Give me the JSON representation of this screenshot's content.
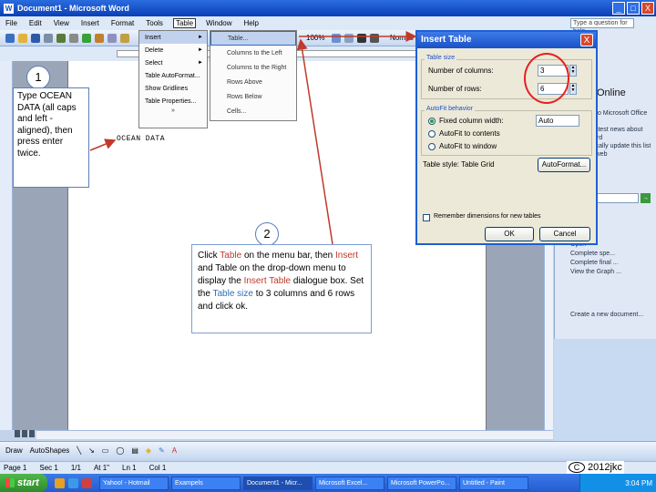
{
  "window": {
    "title": "Document1 - Microsoft Word",
    "app_icon": "W",
    "minimize": "_",
    "maximize": "□",
    "close": "X"
  },
  "menu": {
    "items": [
      "File",
      "Edit",
      "View",
      "Insert",
      "Format",
      "Tools",
      "Table",
      "Window",
      "Help"
    ],
    "active": "Table",
    "ask_box": "Type a question for help"
  },
  "toolbar": {
    "zoom": "100%",
    "style": "Normal"
  },
  "table_menu": {
    "items": [
      {
        "label": "Insert",
        "arrow": "►"
      },
      {
        "label": "Delete",
        "arrow": "►"
      },
      {
        "label": "Select",
        "arrow": "►"
      },
      {
        "label": "Table AutoFormat...",
        "arrow": ""
      },
      {
        "label": "Show Gridlines",
        "arrow": ""
      },
      {
        "label": "Table Properties...",
        "arrow": ""
      }
    ],
    "more": "»"
  },
  "insert_submenu": {
    "items": [
      "Table...",
      "Columns to the Left",
      "Columns to the Right",
      "Rows Above",
      "Rows Below",
      "Cells..."
    ]
  },
  "dialog": {
    "title": "Insert Table",
    "close": "X",
    "table_size_label": "Table size",
    "columns_label": "Number of columns:",
    "columns_value": "3",
    "rows_label": "Number of rows:",
    "rows_value": "6",
    "autofit_label": "AutoFit behavior",
    "fixed_label": "Fixed column width:",
    "fixed_value": "Auto",
    "autofit_contents": "AutoFit to contents",
    "autofit_window": "AutoFit to window",
    "table_style_label": "Table style: Table Grid",
    "autoformat_button": "AutoFormat...",
    "remember_label": "Remember dimensions for new tables",
    "ok": "OK",
    "cancel": "Cancel",
    "spin_up": "▲",
    "spin_down": "▼"
  },
  "document": {
    "text": "OCEAN DATA"
  },
  "callout1": {
    "number": "1",
    "text": "Type OCEAN DATA (all caps and left -aligned), then press enter twice."
  },
  "callout2": {
    "number": "2",
    "p1": "Click ",
    "table1": "Table",
    "p2": " on the menu bar, then ",
    "insert1": "Insert",
    "p3": " and Table on the drop-down menu to display the ",
    "insert_table": "Insert Table",
    "p4": " dialogue box. Set the ",
    "table_size": "Table size",
    "p5": " to 3 columns and 6 rows and click ok."
  },
  "task_pane": {
    "online": "Online",
    "links": [
      "Connect to Microsoft Office Online",
      "Get the latest news about using Word",
      "Automatically update this list from the web"
    ],
    "search_go": "→",
    "recent": [
      "Open",
      "Complete spe...",
      "Complete final ...",
      "View the Graph ..."
    ],
    "new_document": "Create a new document..."
  },
  "drawing_bar": {
    "draw": "Draw",
    "autoshapes": "AutoShapes"
  },
  "status_bar": {
    "page": "Page 1",
    "sec": "Sec 1",
    "pos": "1/1",
    "at": "At 1\"",
    "ln": "Ln 1",
    "col": "Col 1"
  },
  "taskbar": {
    "start": "start",
    "items": [
      "Yahoo! - Hotmail",
      "Exampels",
      "Document1 - Micr...",
      "Microsoft Excel...",
      "Microsoft PowerPo...",
      "Untitled - Paint"
    ],
    "tray_time": "3:04 PM"
  },
  "copyright": {
    "symbol": "C",
    "text": "2012jkc"
  }
}
